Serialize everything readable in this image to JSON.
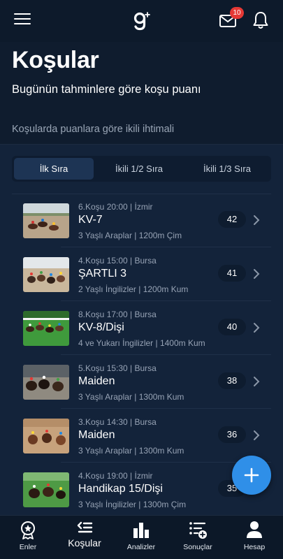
{
  "header": {
    "notification_count": "10",
    "icons": [
      "menu-icon",
      "logo-icon",
      "mail-icon",
      "bell-icon"
    ]
  },
  "hero": {
    "title": "Koşular",
    "subtitle": "Bugünün tahminlere göre koşu puanı"
  },
  "section": {
    "label": "Koşularda puanlara göre ikili ihtimali"
  },
  "tabs": [
    {
      "label": "İlk Sıra",
      "active": true
    },
    {
      "label": "İkili 1/2 Sıra",
      "active": false
    },
    {
      "label": "İkili 1/3 Sıra",
      "active": false
    }
  ],
  "races": [
    {
      "meta": "6.Koşu 20:00 | İzmir",
      "name": "KV-7",
      "detail": "3 Yaşlı Araplar | 1200m Çim",
      "score": "42"
    },
    {
      "meta": "4.Koşu 15:00 | Bursa",
      "name": "ŞARTLI 3",
      "detail": "2 Yaşlı İngilizler | 1200m Kum",
      "score": "41"
    },
    {
      "meta": "8.Koşu 17:00 | Bursa",
      "name": "KV-8/Dişi",
      "detail": "4 ve Yukarı İngilizler | 1400m Kum",
      "score": "40"
    },
    {
      "meta": "5.Koşu 15:30 | Bursa",
      "name": "Maiden",
      "detail": "3 Yaşlı Araplar | 1300m Kum",
      "score": "38"
    },
    {
      "meta": "3.Koşu 14:30 | Bursa",
      "name": "Maiden",
      "detail": "3 Yaşlı Araplar | 1300m Kum",
      "score": "36"
    },
    {
      "meta": "4.Koşu 19:00 | İzmir",
      "name": "Handikap 15/Dişi",
      "detail": "3 Yaşlı İngilizler | 1300m Çim",
      "score": "35"
    }
  ],
  "fab": {
    "icon": "plus-icon"
  },
  "bottom_nav": [
    {
      "label": "Enler",
      "icon": "medal-icon",
      "active": false
    },
    {
      "label": "Koşular",
      "icon": "race-list-icon",
      "active": true
    },
    {
      "label": "Analizler",
      "icon": "bar-chart-icon",
      "active": false
    },
    {
      "label": "Sonuçlar",
      "icon": "results-list-icon",
      "active": false
    },
    {
      "label": "Hesap",
      "icon": "person-icon",
      "active": false
    }
  ],
  "colors": {
    "background": "#0f1c2e",
    "panel": "#13233a",
    "accent": "#2f8fe8",
    "badge": "#e53935"
  }
}
